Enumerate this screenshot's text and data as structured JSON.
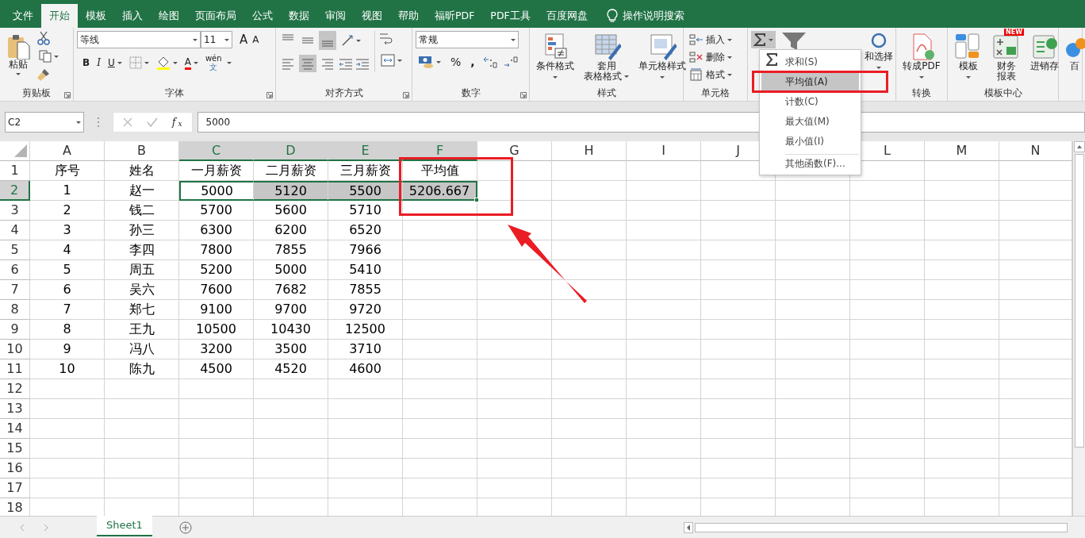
{
  "tabs": [
    {
      "label": "文件",
      "selected": false
    },
    {
      "label": "开始",
      "selected": true
    },
    {
      "label": "模板",
      "selected": false
    },
    {
      "label": "插入",
      "selected": false
    },
    {
      "label": "绘图",
      "selected": false
    },
    {
      "label": "页面布局",
      "selected": false
    },
    {
      "label": "公式",
      "selected": false
    },
    {
      "label": "数据",
      "selected": false
    },
    {
      "label": "审阅",
      "selected": false
    },
    {
      "label": "视图",
      "selected": false
    },
    {
      "label": "帮助",
      "selected": false
    },
    {
      "label": "福昕PDF",
      "selected": false
    },
    {
      "label": "PDF工具",
      "selected": false
    },
    {
      "label": "百度网盘",
      "selected": false
    }
  ],
  "tell_me": "操作说明搜索",
  "ribbon": [
    {
      "kind": "clipboard",
      "label": "剪贴板",
      "launcher": true,
      "paste": "粘贴"
    },
    {
      "kind": "font",
      "label": "字体",
      "launcher": true,
      "font": "等线",
      "size": "11",
      "grow": "A",
      "shrink": "A",
      "bold": "B",
      "italic": "I",
      "underline": "U",
      "font_color_glyph": "A",
      "phonetic": "wén",
      "phonetic_sub": "文"
    },
    {
      "kind": "alignment",
      "label": "对齐方式",
      "launcher": true,
      "vertical": [
        {
          "selected": false
        },
        {
          "selected": false
        },
        {
          "selected": true
        }
      ],
      "horizontal": [
        {
          "selected": false
        },
        {
          "selected": true
        },
        {
          "selected": false
        }
      ]
    },
    {
      "kind": "number",
      "label": "数字",
      "launcher": true,
      "format": "常规",
      "percent": "%",
      "comma": ","
    },
    {
      "kind": "large",
      "label": "样式",
      "buttons": [
        {
          "lines": [
            "条件格式"
          ],
          "dropdown": true
        },
        {
          "lines": [
            "套用",
            "表格格式"
          ],
          "dropdown": true
        },
        {
          "lines": [
            "单元格样式"
          ],
          "dropdown": true
        }
      ]
    },
    {
      "kind": "cells",
      "label": "单元格",
      "buttons": [
        "插入",
        "删除",
        "格式"
      ]
    },
    {
      "kind": "editing",
      "partial_label": "和选择",
      "autosum_open": true
    },
    {
      "kind": "large",
      "label": "转换",
      "buttons": [
        {
          "lines": [
            "转成PDF"
          ],
          "dropdown": true
        }
      ]
    },
    {
      "kind": "large",
      "label": "模板中心",
      "buttons": [
        {
          "lines": [
            "模板"
          ],
          "dropdown": true
        },
        {
          "lines": [
            "财务",
            "报表"
          ],
          "dropdown": false,
          "badge": "NEW"
        },
        {
          "lines": [
            "进销存"
          ],
          "dropdown": false
        }
      ]
    },
    {
      "kind": "large",
      "buttons": [
        {
          "lines": [
            "百"
          ],
          "dropdown": false
        }
      ]
    }
  ],
  "formula_bar": {
    "name_box": "C2",
    "function_label": "f$_{x}$",
    "value": "5000"
  },
  "columns": [
    {
      "label": "A",
      "selected": false
    },
    {
      "label": "B",
      "selected": false
    },
    {
      "label": "C",
      "selected": true
    },
    {
      "label": "D",
      "selected": true
    },
    {
      "label": "E",
      "selected": true
    },
    {
      "label": "F",
      "selected": true
    },
    {
      "label": "G",
      "selected": false
    },
    {
      "label": "H",
      "selected": false
    },
    {
      "label": "I",
      "selected": false
    },
    {
      "label": "J",
      "selected": false
    },
    {},
    {
      "label": "L",
      "selected": false
    },
    {
      "label": "M",
      "selected": false
    },
    {
      "label": "N",
      "selected": false
    }
  ],
  "rows": [
    {
      "label": "1",
      "selected": false,
      "cells": [
        {
          "text": "序号",
          "selected": false
        },
        {
          "text": "姓名",
          "selected": false
        },
        {
          "text": "一月薪资",
          "selected": false
        },
        {
          "text": "二月薪资",
          "selected": false
        },
        {
          "text": "三月薪资",
          "selected": false
        },
        {
          "text": "平均值",
          "selected": false
        }
      ]
    },
    {
      "label": "2",
      "selected": true,
      "cells": [
        {
          "text": "1",
          "selected": false
        },
        {
          "text": "赵一",
          "selected": false
        },
        {
          "text": "5000",
          "selected": true,
          "active": true
        },
        {
          "text": "5120",
          "selected": true
        },
        {
          "text": "5500",
          "selected": true
        },
        {
          "text": "5206.667",
          "selected": true
        }
      ]
    },
    {
      "label": "3",
      "selected": false,
      "cells": [
        {
          "text": "2",
          "selected": false
        },
        {
          "text": "钱二",
          "selected": false
        },
        {
          "text": "5700",
          "selected": false
        },
        {
          "text": "5600",
          "selected": false
        },
        {
          "text": "5710",
          "selected": false
        }
      ]
    },
    {
      "label": "4",
      "selected": false,
      "cells": [
        {
          "text": "3",
          "selected": false
        },
        {
          "text": "孙三",
          "selected": false
        },
        {
          "text": "6300",
          "selected": false
        },
        {
          "text": "6200",
          "selected": false
        },
        {
          "text": "6520",
          "selected": false
        }
      ]
    },
    {
      "label": "5",
      "selected": false,
      "cells": [
        {
          "text": "4",
          "selected": false
        },
        {
          "text": "李四",
          "selected": false
        },
        {
          "text": "7800",
          "selected": false
        },
        {
          "text": "7855",
          "selected": false
        },
        {
          "text": "7966",
          "selected": false
        }
      ]
    },
    {
      "label": "6",
      "selected": false,
      "cells": [
        {
          "text": "5",
          "selected": false
        },
        {
          "text": "周五",
          "selected": false
        },
        {
          "text": "5200",
          "selected": false
        },
        {
          "text": "5000",
          "selected": false
        },
        {
          "text": "5410",
          "selected": false
        }
      ]
    },
    {
      "label": "7",
      "selected": false,
      "cells": [
        {
          "text": "6",
          "selected": false
        },
        {
          "text": "吴六",
          "selected": false
        },
        {
          "text": "7600",
          "selected": false
        },
        {
          "text": "7682",
          "selected": false
        },
        {
          "text": "7855",
          "selected": false
        }
      ]
    },
    {
      "label": "8",
      "selected": false,
      "cells": [
        {
          "text": "7",
          "selected": false
        },
        {
          "text": "郑七",
          "selected": false
        },
        {
          "text": "9100",
          "selected": false
        },
        {
          "text": "9700",
          "selected": false
        },
        {
          "text": "9720",
          "selected": false
        }
      ]
    },
    {
      "label": "9",
      "selected": false,
      "cells": [
        {
          "text": "8",
          "selected": false
        },
        {
          "text": "王九",
          "selected": false
        },
        {
          "text": "10500",
          "selected": false
        },
        {
          "text": "10430",
          "selected": false
        },
        {
          "text": "12500",
          "selected": false
        }
      ]
    },
    {
      "label": "10",
      "selected": false,
      "cells": [
        {
          "text": "9",
          "selected": false
        },
        {
          "text": "冯八",
          "selected": false
        },
        {
          "text": "3200",
          "selected": false
        },
        {
          "text": "3500",
          "selected": false
        },
        {
          "text": "3710",
          "selected": false
        }
      ]
    },
    {
      "label": "11",
      "selected": false,
      "cells": [
        {
          "text": "10",
          "selected": false
        },
        {
          "text": "陈九",
          "selected": false
        },
        {
          "text": "4500",
          "selected": false
        },
        {
          "text": "4520",
          "selected": false
        },
        {
          "text": "4600",
          "selected": false
        }
      ]
    },
    {
      "label": "12",
      "selected": false
    },
    {
      "label": "13",
      "selected": false
    },
    {
      "label": "14",
      "selected": false
    },
    {
      "label": "15",
      "selected": false
    },
    {
      "label": "16",
      "selected": false
    },
    {
      "label": "17",
      "selected": false
    },
    {
      "label": "18",
      "selected": false
    }
  ],
  "autosum_menu": [
    {
      "label": "求和(S)",
      "selected": false,
      "separator_before": false
    },
    {
      "label": "平均值(A)",
      "selected": true,
      "separator_before": false
    },
    {
      "label": "计数(C)",
      "selected": false,
      "separator_before": false
    },
    {
      "label": "最大值(M)",
      "selected": false,
      "separator_before": false
    },
    {
      "label": "最小值(I)",
      "selected": false,
      "separator_before": false
    },
    {
      "label": "其他函数(F)...",
      "selected": false,
      "separator_before": true
    }
  ],
  "sheet_tabs": [
    {
      "label": "Sheet1",
      "selected": true
    }
  ]
}
